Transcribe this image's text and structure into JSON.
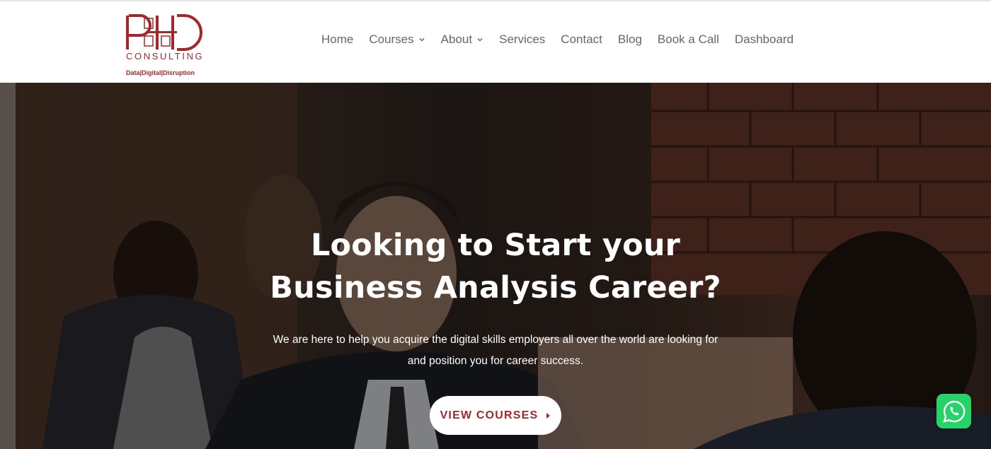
{
  "brand": {
    "logo_letters": "PHD",
    "logo_word": "CONSULTING",
    "tagline": "Data|Digital|Disruption",
    "accent_color": "#a3282d"
  },
  "nav": {
    "items": [
      {
        "label": "Home",
        "has_dropdown": false
      },
      {
        "label": "Courses",
        "has_dropdown": true
      },
      {
        "label": "About",
        "has_dropdown": true
      },
      {
        "label": "Services",
        "has_dropdown": false
      },
      {
        "label": "Contact",
        "has_dropdown": false
      },
      {
        "label": "Blog",
        "has_dropdown": false
      },
      {
        "label": "Book a Call",
        "has_dropdown": false
      },
      {
        "label": "Dashboard",
        "has_dropdown": false
      }
    ]
  },
  "hero": {
    "title_line1": "Looking to Start your",
    "title_line2": "Business Analysis Career?",
    "subtitle_line1": "We are here to help you acquire the digital skills employers all over the world are looking for",
    "subtitle_line2": "and position you for career success.",
    "cta_label": "VIEW COURSES"
  },
  "floating": {
    "whatsapp_icon": "whatsapp-icon",
    "whatsapp_color": "#25d366"
  }
}
